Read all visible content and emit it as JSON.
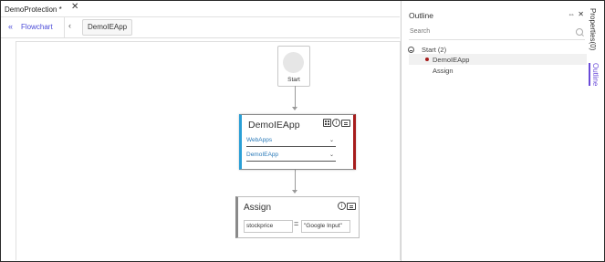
{
  "doc_tab": {
    "title": "DemoProtection *",
    "close": "✕"
  },
  "breadcrumb": {
    "back": "«",
    "flowchart": "Flowchart",
    "prev": "‹",
    "current": "DemoIEApp"
  },
  "flowchart": {
    "start": {
      "label": "Start"
    },
    "activity": {
      "title": "DemoIEApp",
      "field1": "WebApps",
      "field2": "DemoIEApp",
      "dropdown": "⌄",
      "accent_left": "#2a9fd6",
      "accent_right": "#a61c1c"
    },
    "assign": {
      "title": "Assign",
      "variable": "stockprice",
      "equals": "=",
      "value": "\"Google Input\""
    }
  },
  "outline": {
    "title": "Outline",
    "pin": "⇔",
    "close": "✕",
    "search_placeholder": "Search",
    "tree": [
      {
        "label": "Start (2)"
      },
      {
        "label": "DemoIEApp"
      },
      {
        "label": "Assign"
      }
    ]
  },
  "side_tabs": {
    "properties": "Properties(0)",
    "outline": "Outline"
  }
}
